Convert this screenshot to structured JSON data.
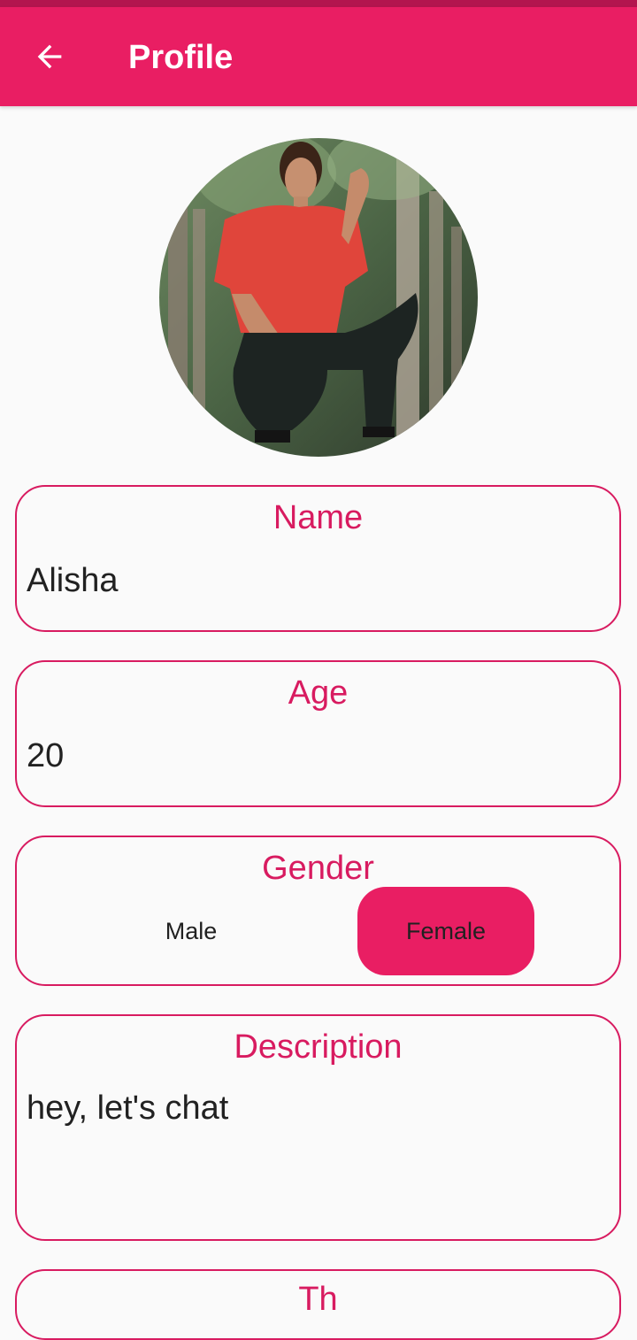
{
  "app_bar": {
    "title": "Profile",
    "accent": "#e91e63",
    "back_icon": "arrow-left-icon"
  },
  "profile": {
    "avatar_alt": "profile photo"
  },
  "fields": {
    "name": {
      "label": "Name",
      "value": "Alisha"
    },
    "age": {
      "label": "Age",
      "value": "20"
    },
    "gender": {
      "label": "Gender",
      "options": [
        "Male",
        "Female"
      ],
      "selected": "Female"
    },
    "description": {
      "label": "Description",
      "value": "hey, let's chat"
    },
    "next": {
      "label": "Th"
    }
  }
}
